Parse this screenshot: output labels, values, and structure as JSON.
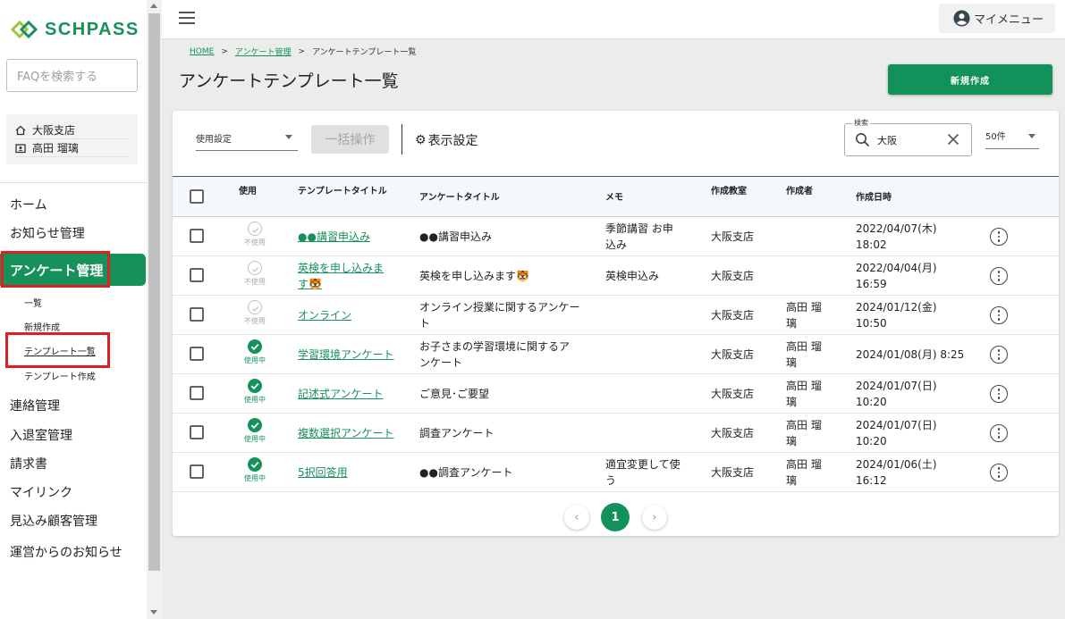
{
  "app": {
    "logo_text": "SCHPASS"
  },
  "sidebar": {
    "faq_placeholder": "FAQを検索する",
    "branch": "大阪支店",
    "user": "高田 瑠璃",
    "items": [
      {
        "label": "ホーム"
      },
      {
        "label": "お知らせ管理"
      },
      {
        "label": "アンケート管理"
      },
      {
        "label": "連絡管理"
      },
      {
        "label": "入退室管理"
      },
      {
        "label": "請求書"
      },
      {
        "label": "マイリンク"
      },
      {
        "label": "見込み顧客管理"
      },
      {
        "label": "運営からのお知らせ"
      }
    ],
    "sub_items": [
      {
        "label": "一覧"
      },
      {
        "label": "新規作成"
      },
      {
        "label": "テンプレート一覧"
      },
      {
        "label": "テンプレート作成"
      }
    ]
  },
  "header": {
    "my_menu": "マイメニュー"
  },
  "breadcrumb": {
    "home": "HOME",
    "survey": "アンケート管理",
    "current": "アンケートテンプレート一覧"
  },
  "page": {
    "title": "アンケートテンプレート一覧",
    "new_button": "新規作成"
  },
  "toolbar": {
    "use_setting": "使用設定",
    "bulk": "一括操作",
    "display_setting": "表示設定",
    "search_label": "検索",
    "search_value": "大阪",
    "per_page": "50件"
  },
  "table": {
    "headers": {
      "use": "使用",
      "template_title": "テンプレートタイトル",
      "survey_title": "アンケートタイトル",
      "memo": "メモ",
      "classroom": "作成教室",
      "author": "作成者",
      "created": "作成日時"
    },
    "rows": [
      {
        "use": "off",
        "use_label": "不使用",
        "template_title_1": "●●講習申込み",
        "template_title_2": "",
        "survey_title_1": "●●講習申込み",
        "survey_title_2": "",
        "memo_1": "季節講習 お申",
        "memo_2": "込み",
        "classroom": "大阪支店",
        "author_1": "",
        "author_2": "",
        "created_1": "2022/04/07(木)",
        "created_2": "18:02"
      },
      {
        "use": "off",
        "use_label": "不使用",
        "template_title_1": "英検を申し込みま",
        "template_title_2": "す🐯",
        "survey_title_1": "英検を申し込みます🐯",
        "survey_title_2": "",
        "memo_1": "英検申込み",
        "memo_2": "",
        "classroom": "大阪支店",
        "author_1": "",
        "author_2": "",
        "created_1": "2022/04/04(月)",
        "created_2": "16:59"
      },
      {
        "use": "off",
        "use_label": "不使用",
        "template_title_1": "オンライン",
        "template_title_2": "",
        "survey_title_1": "オンライン授業に関するアンケー",
        "survey_title_2": "ト",
        "memo_1": "",
        "memo_2": "",
        "classroom": "大阪支店",
        "author_1": "高田 瑠",
        "author_2": "璃",
        "created_1": "2024/01/12(金)",
        "created_2": "10:50"
      },
      {
        "use": "on",
        "use_label": "使用中",
        "template_title_1": "学習環境アンケート",
        "template_title_2": "",
        "survey_title_1": "お子さまの学習環境に関するア",
        "survey_title_2": "ンケート",
        "memo_1": "",
        "memo_2": "",
        "classroom": "大阪支店",
        "author_1": "高田 瑠",
        "author_2": "璃",
        "created_1": "2024/01/08(月) 8:25",
        "created_2": ""
      },
      {
        "use": "on",
        "use_label": "使用中",
        "template_title_1": "記述式アンケート",
        "template_title_2": "",
        "survey_title_1": "ご意見･ご要望",
        "survey_title_2": "",
        "memo_1": "",
        "memo_2": "",
        "classroom": "大阪支店",
        "author_1": "高田 瑠",
        "author_2": "璃",
        "created_1": "2024/01/07(日)",
        "created_2": "10:20"
      },
      {
        "use": "on",
        "use_label": "使用中",
        "template_title_1": "複数選択アンケート",
        "template_title_2": "",
        "survey_title_1": "調査アンケート",
        "survey_title_2": "",
        "memo_1": "",
        "memo_2": "",
        "classroom": "大阪支店",
        "author_1": "高田 瑠",
        "author_2": "璃",
        "created_1": "2024/01/07(日)",
        "created_2": "10:20"
      },
      {
        "use": "on",
        "use_label": "使用中",
        "template_title_1": "5択回答用",
        "template_title_2": "",
        "survey_title_1": "●●調査アンケート",
        "survey_title_2": "",
        "memo_1": "適宜変更して使",
        "memo_2": "う",
        "classroom": "大阪支店",
        "author_1": "高田 瑠",
        "author_2": "璃",
        "created_1": "2024/01/06(土)",
        "created_2": "16:12"
      }
    ]
  },
  "pagination": {
    "current": "1"
  },
  "colors": {
    "accent": "#16915a",
    "highlight_box": "#e02020"
  }
}
